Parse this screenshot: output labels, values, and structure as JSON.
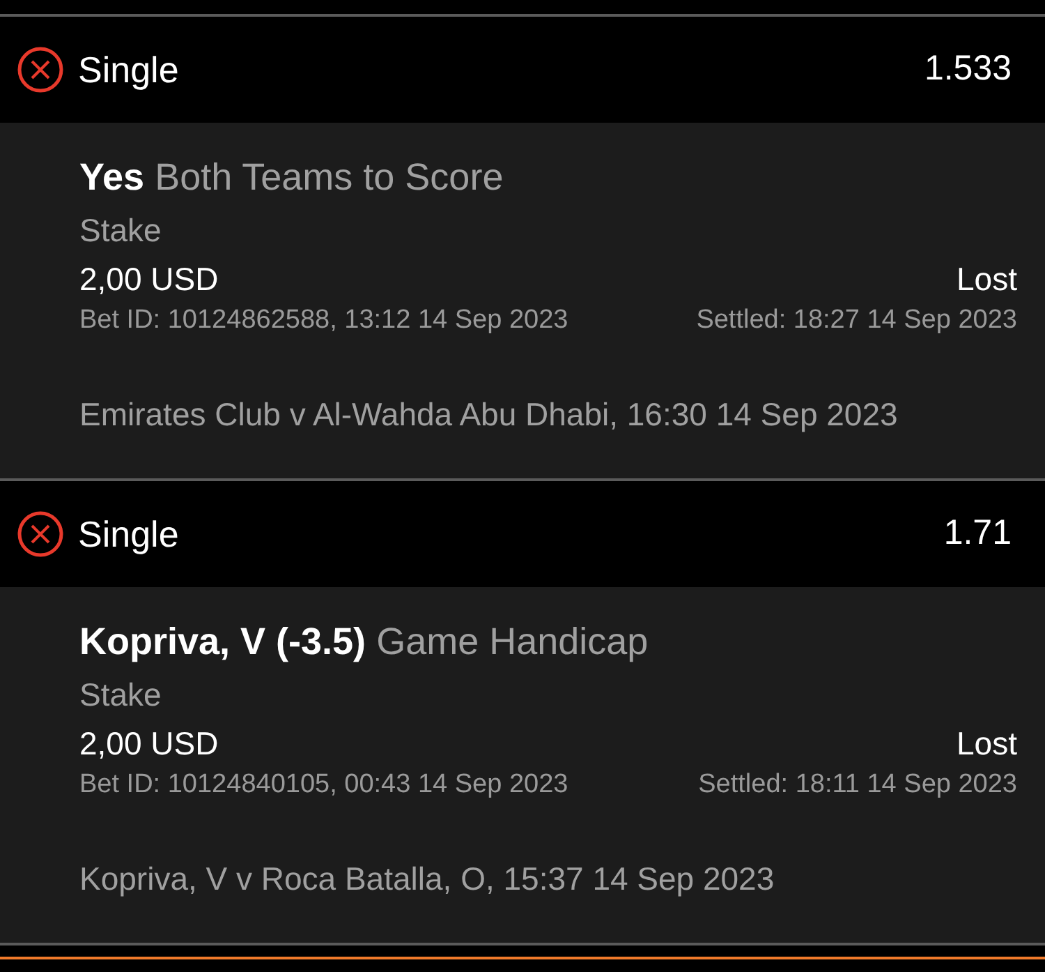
{
  "bets": [
    {
      "lost": true,
      "type": "Single",
      "odds": "1.533",
      "selection": "Yes",
      "market": "Both Teams to Score",
      "stake_label": "Stake",
      "stake": "2,00 USD",
      "result": "Lost",
      "bet_id": "Bet ID: 10124862588, 13:12 14 Sep 2023",
      "settled": "Settled: 18:27 14 Sep 2023",
      "event": "Emirates Club v Al-Wahda Abu Dhabi, 16:30 14 Sep 2023"
    },
    {
      "lost": true,
      "type": "Single",
      "odds": "1.71",
      "selection": "Kopriva, V (-3.5)",
      "market": "Game Handicap",
      "stake_label": "Stake",
      "stake": "2,00 USD",
      "result": "Lost",
      "bet_id": "Bet ID: 10124840105, 00:43 14 Sep 2023",
      "settled": "Settled: 18:11 14 Sep 2023",
      "event": "Kopriva, V v Roca Batalla, O, 15:37 14 Sep 2023"
    }
  ]
}
